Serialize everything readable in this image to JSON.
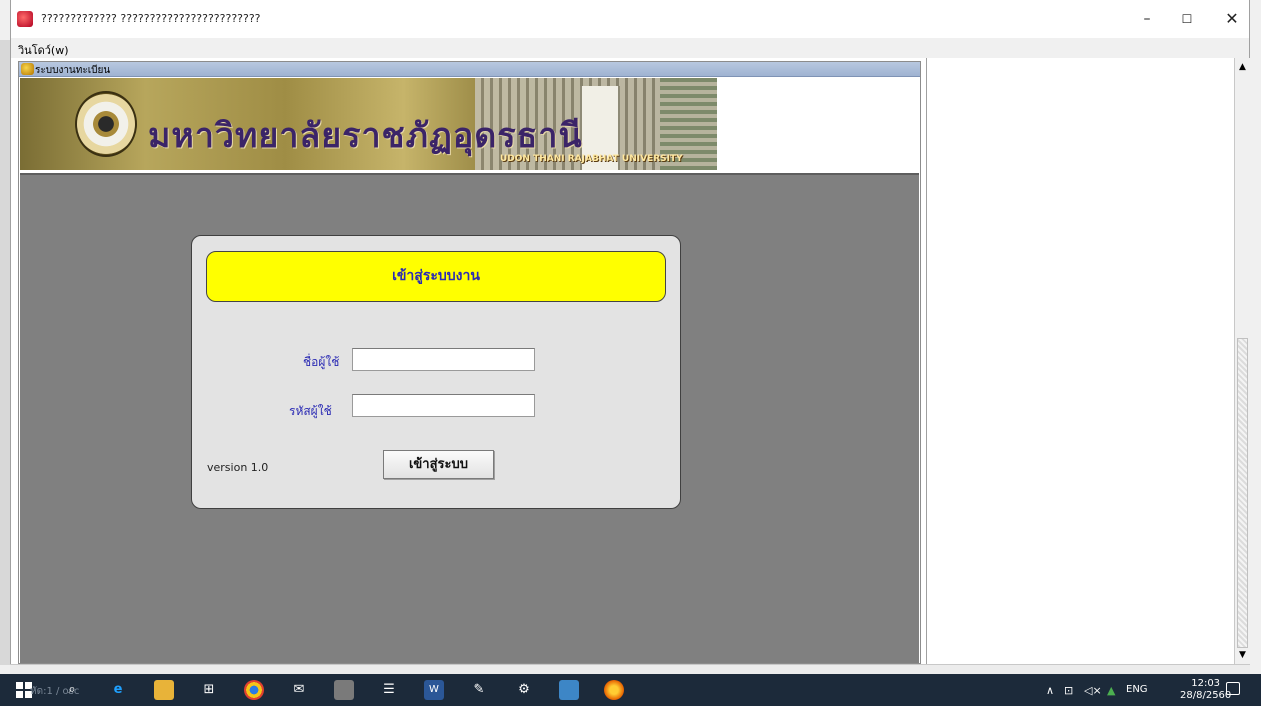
{
  "window": {
    "title": "????????????? ????????????????????????",
    "controls": {
      "minimize": "–",
      "maximize": "☐",
      "close": "✕"
    }
  },
  "menubar": {
    "items": [
      "วินโดว์(w)"
    ]
  },
  "internal_frame": {
    "title": "ระบบงานทะเบียน"
  },
  "banner": {
    "title_th": "มหาวิทยาลัยราชภัฏอุดรธานี",
    "title_en": "UDON THANI RAJABHAT UNIVERSITY"
  },
  "login": {
    "heading": "เข้าสู่ระบบงาน",
    "username_label": "ชื่อผู้ใช้",
    "username_value": "",
    "password_label": "รหัสผู้ใช้",
    "password_value": "",
    "version": "version 1.0",
    "submit_label": "เข้าสู่ระบบ"
  },
  "taskbar": {
    "ghost_text": "หัด:1 / osc",
    "tray": {
      "input_lang": "ENG",
      "time": "12:03",
      "date": "28/8/2560"
    }
  },
  "colors": {
    "login_heading_bg": "#ffff00",
    "label_text": "#2c2cb4",
    "content_bg": "#808080",
    "taskbar_bg": "#1c2a3a"
  }
}
